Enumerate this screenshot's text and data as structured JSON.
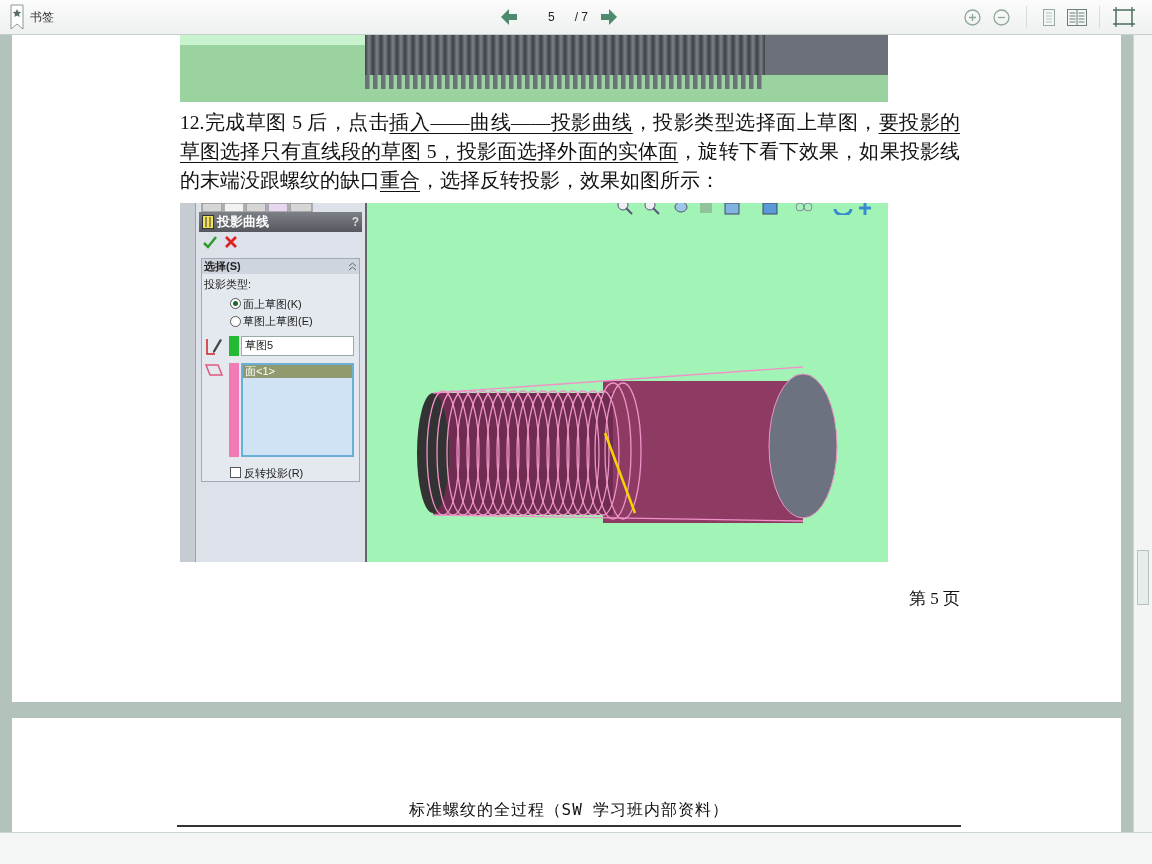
{
  "toolbar": {
    "bookmarks_label": "书签",
    "page_number": "5",
    "page_total": "/ 7"
  },
  "page": {
    "paragraph": [
      {
        "text": "12.完成草图 5 后，点击",
        "underlined": false
      },
      {
        "text": "插入——曲线——投影曲线",
        "underlined": true
      },
      {
        "text": "，投影类型选择面上草图，",
        "underlined": false
      },
      {
        "text": "要投影的草图选择只有直线段的草图 5，投影面选择外面的实体面",
        "underlined": true
      },
      {
        "text": "，旋转下看下效果，如果投影线的末端没跟螺纹的缺口",
        "underlined": false
      },
      {
        "text": "重合",
        "underlined": true
      },
      {
        "text": "，选择反转投影，效果如图所示：",
        "underlined": false
      }
    ],
    "figure": {
      "panel_title": "投影曲线",
      "help": "?",
      "section_title": "选择(S)",
      "type_label": "投影类型:",
      "options": [
        {
          "label": "面上草图(K)",
          "selected": true
        },
        {
          "label": "草图上草图(E)",
          "selected": false
        }
      ],
      "sketch_field": "草图5",
      "face_list": [
        {
          "label": "面<1>",
          "selected": true
        }
      ],
      "reverse": {
        "label": "反转投影(R)",
        "checked": false
      }
    },
    "footer": "第 5 页"
  },
  "next_page": {
    "header": "标准螺纹的全过程（SW 学习班内部资料）"
  }
}
